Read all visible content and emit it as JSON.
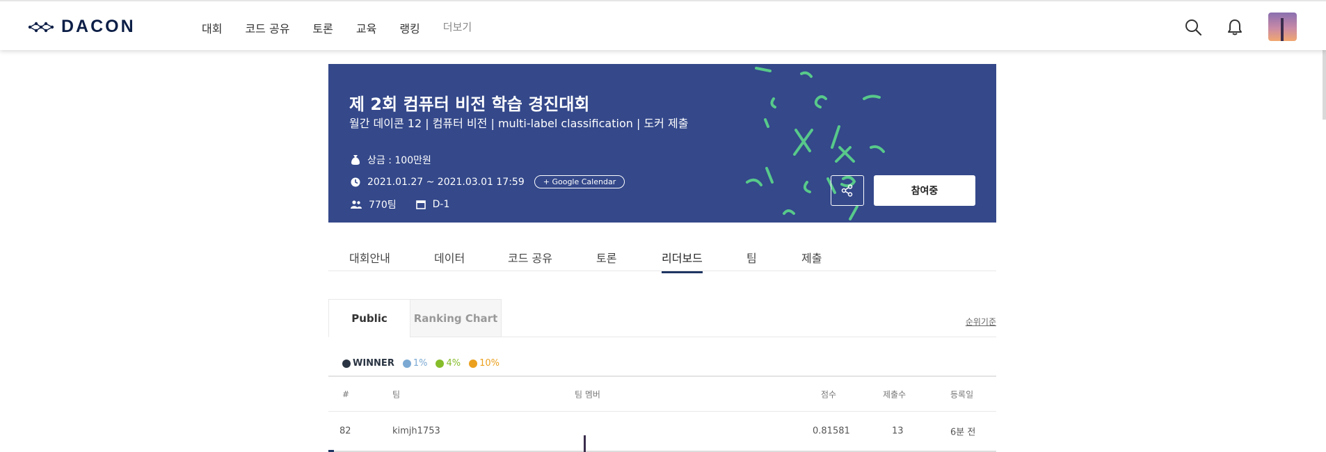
{
  "header": {
    "logo_text": "DACON",
    "nav": [
      "대회",
      "코드 공유",
      "토론",
      "교육",
      "랭킹",
      "더보기"
    ]
  },
  "banner": {
    "title": "제 2회 컴퓨터 비전 학습 경진대회",
    "subtitle": "월간 데이콘 12 | 컴퓨터 비전 | multi-label classification | 도커 제출",
    "prize": "상금 : 100만원",
    "period": "2021.01.27 ~ 2021.03.01 17:59",
    "calendar_button": "+ Google Calendar",
    "teams": "770팀",
    "dday": "D-1",
    "join_button": "참여중",
    "bg_color": "#34488a"
  },
  "tabs": [
    "대회안내",
    "데이터",
    "코드 공유",
    "토론",
    "리더보드",
    "팀",
    "제출"
  ],
  "active_tab": "리더보드",
  "leaderboard": {
    "subtabs": [
      "Public",
      "Ranking Chart"
    ],
    "rank_criteria_link": "순위기준",
    "legend": [
      {
        "label": "WINNER",
        "color": "#2a3442"
      },
      {
        "label": "1%",
        "color": "#7ba9d3"
      },
      {
        "label": "4%",
        "color": "#86bd2a"
      },
      {
        "label": "10%",
        "color": "#eba01e"
      }
    ],
    "columns": [
      "#",
      "팀",
      "팀 멤버",
      "점수",
      "제출수",
      "등록일"
    ],
    "rows": [
      {
        "rank": "82",
        "team": "kimjh1753",
        "score": "0.81581",
        "submissions": "13",
        "registered": "6분 전"
      }
    ]
  }
}
